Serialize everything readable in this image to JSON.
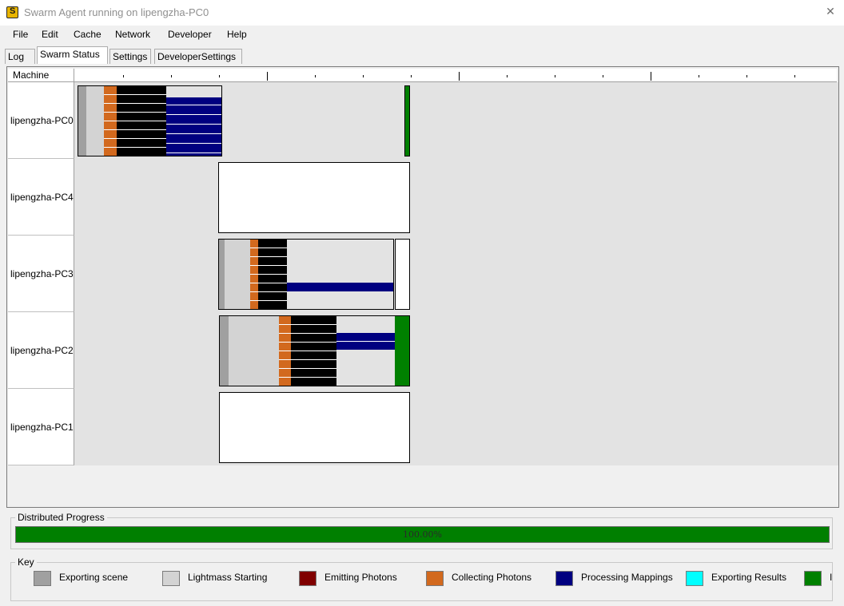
{
  "window": {
    "title": "Swarm Agent running on lipengzha-PC0",
    "close_glyph": "✕"
  },
  "menu": [
    "File",
    "Edit",
    "Cache",
    "Network",
    "Developer",
    "Help"
  ],
  "tabs": [
    "Log",
    "Swarm Status",
    "Settings",
    "DeveloperSettings"
  ],
  "active_tab": "Swarm Status",
  "status": {
    "machine_header": "Machine",
    "machines": [
      "lipengzha-PC0",
      "lipengzha-PC4",
      "lipengzha-PC3",
      "lipengzha-PC2",
      "lipengzha-PC1"
    ]
  },
  "progress": {
    "label": "Distributed Progress",
    "text": "100.00%",
    "value": 1.0
  },
  "key": {
    "label": "Key",
    "items": [
      {
        "label": "Exporting scene",
        "color": "#a0a0a0"
      },
      {
        "label": "Lightmass Starting",
        "color": "#d3d3d3"
      },
      {
        "label": "Emitting Photons",
        "color": "#800000"
      },
      {
        "label": "Collecting Photons",
        "color": "#d2691e"
      },
      {
        "label": "Processing Mappings",
        "color": "#000080"
      },
      {
        "label": "Exporting Results",
        "color": "#00ffff"
      },
      {
        "label": "I",
        "color": "#008000"
      }
    ]
  },
  "colors": {
    "exporting_scene": "#a0a0a0",
    "lightmass_starting": "#d3d3d3",
    "collecting_photons": "#d2691e",
    "black_band": "#000000",
    "processing_mappings": "#000080",
    "complete": "#008000",
    "idle": "#ffffff",
    "timeline_bg": "#e3e3e3"
  }
}
